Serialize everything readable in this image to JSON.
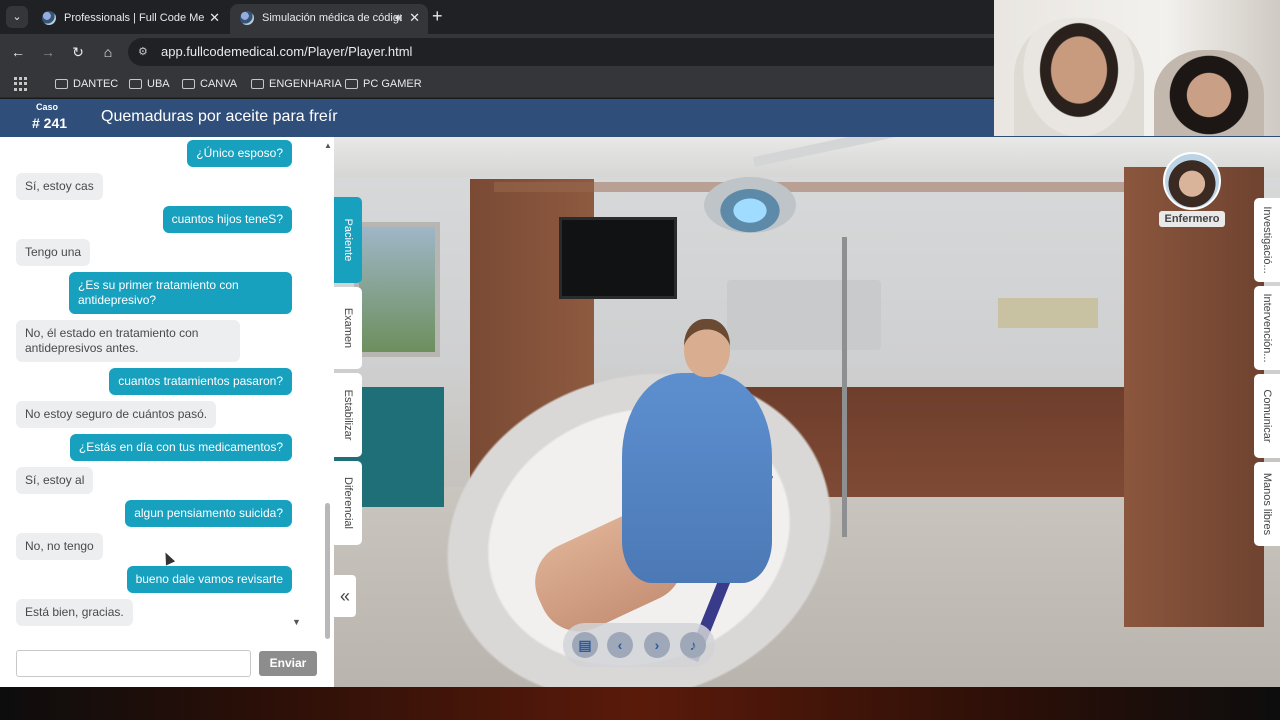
{
  "browser": {
    "tabs": [
      {
        "title": "Professionals | Full Code Medical",
        "active": false,
        "audio": false
      },
      {
        "title": "Simulación médica de código",
        "active": true,
        "audio": true
      }
    ],
    "url": "app.fullcodemedical.com/Player/Player.html",
    "bookmarks": [
      "DANTEC",
      "UBA",
      "CANVA",
      "ENGENHARIA",
      "PC GAMER"
    ]
  },
  "header": {
    "case_label": "Caso",
    "case_number": "# 241",
    "title": "Quemaduras por aceite para freír"
  },
  "chat": {
    "messages": [
      {
        "from": "user",
        "text": "¿Único esposo?"
      },
      {
        "from": "patient",
        "text": "Sí, estoy cas"
      },
      {
        "from": "user",
        "text": "cuantos hijos teneS?"
      },
      {
        "from": "patient",
        "text": "Tengo una"
      },
      {
        "from": "user",
        "text": "¿Es su primer tratamiento con antidepresivo?"
      },
      {
        "from": "patient",
        "text": "No, él estado en tratamiento con antidepresivos antes."
      },
      {
        "from": "user",
        "text": "cuantos tratamientos pasaron?"
      },
      {
        "from": "patient",
        "text": "No estoy seguro de cuántos pasó."
      },
      {
        "from": "user",
        "text": "¿Estás en día con tus medicamentos?"
      },
      {
        "from": "patient",
        "text": "Sí, estoy al"
      },
      {
        "from": "user",
        "text": "algun pensiamento suicida?"
      },
      {
        "from": "patient",
        "text": "No, no tengo"
      },
      {
        "from": "user",
        "text": "bueno dale vamos revisarte"
      },
      {
        "from": "patient",
        "text": "Está bien, gracias."
      }
    ],
    "input_value": "",
    "send_label": "Enviar"
  },
  "left_tabs": [
    "Pacientе",
    "Examen",
    "Estabilizar",
    "Diferencial"
  ],
  "right_tabs": [
    "Investigació...",
    "Intervención...",
    "Comunicar",
    "Manos libres"
  ],
  "nurse_label": "Enfermero",
  "controls": {
    "icons": [
      "notes-icon",
      "chevron-left-icon",
      "chevron-right-icon",
      "speaker-icon"
    ]
  },
  "colors": {
    "header_bg": "#2f4f7a",
    "user_bubble": "#18a0bf",
    "patient_bubble": "#eceeef",
    "active_tab": "#18a0bf"
  }
}
